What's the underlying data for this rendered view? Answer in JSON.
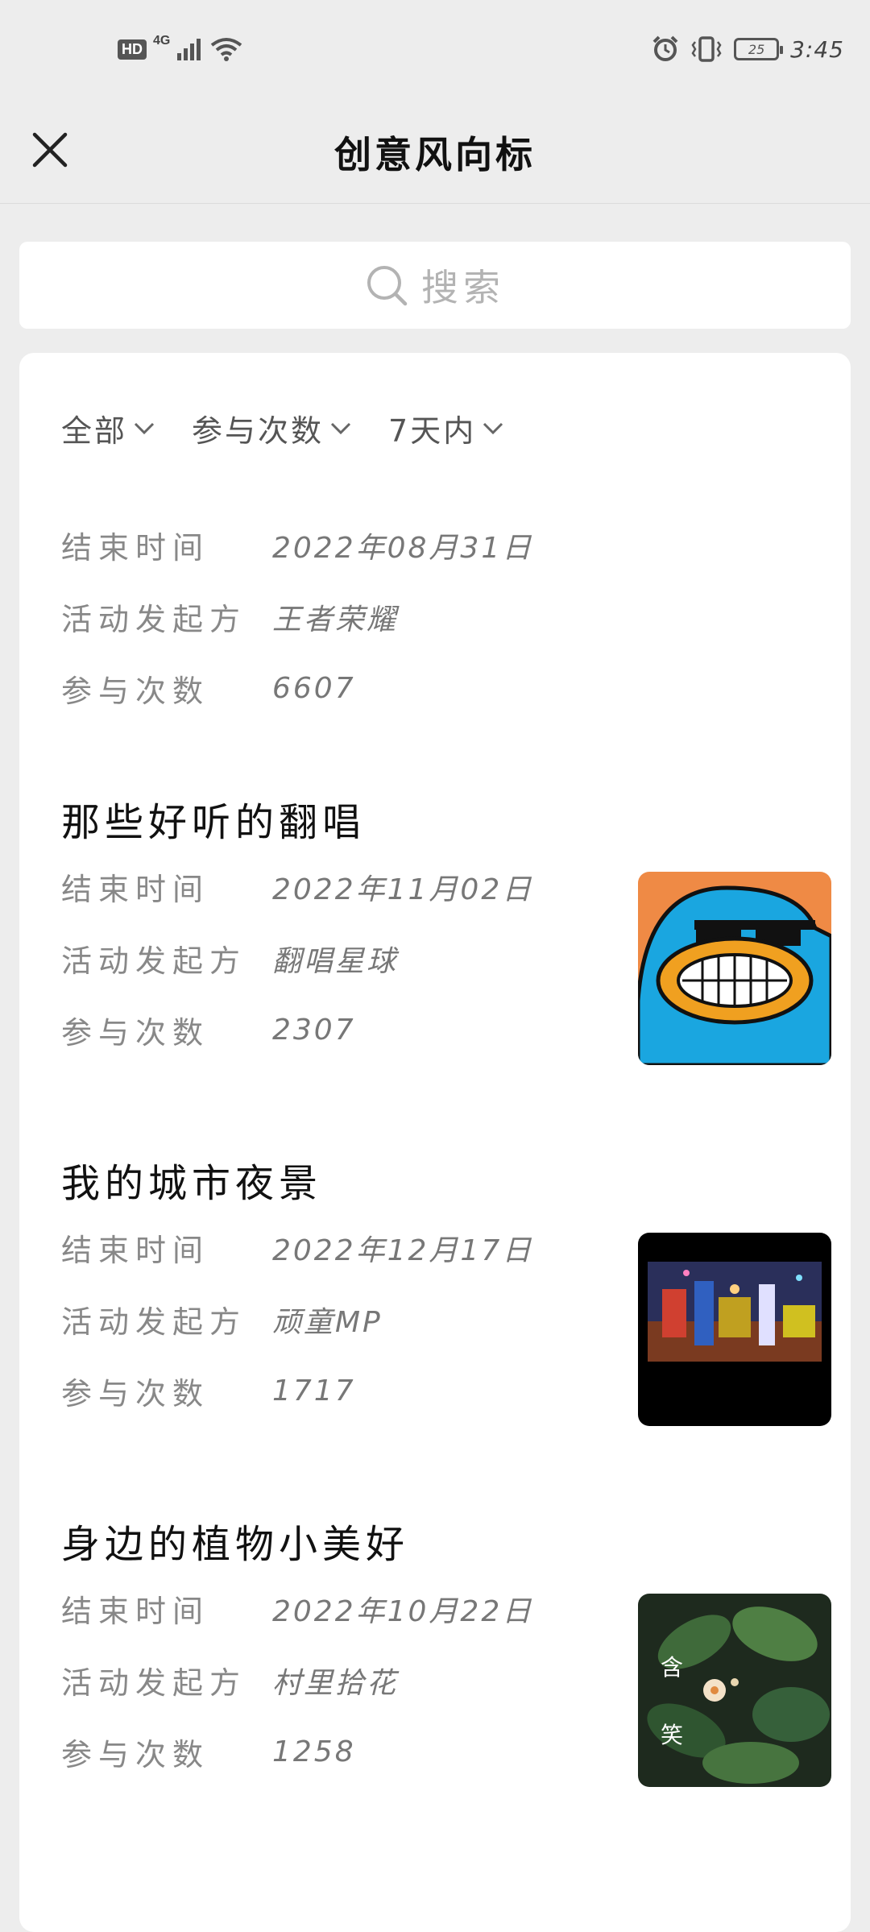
{
  "status_bar": {
    "hd": "HD",
    "network": "4G",
    "battery": "25",
    "time": "3:45"
  },
  "header": {
    "title": "创意风向标"
  },
  "search": {
    "placeholder": "搜索"
  },
  "filters": [
    {
      "label": "全部"
    },
    {
      "label": "参与次数"
    },
    {
      "label": "7天内"
    }
  ],
  "labels": {
    "end_time": "结束时间",
    "organizer": "活动发起方",
    "count": "参与次数"
  },
  "activities": [
    {
      "title": "",
      "end_time": "2022年08月31日",
      "organizer": "王者荣耀",
      "count": "6607"
    },
    {
      "title": "那些好听的翻唱",
      "end_time": "2022年11月02日",
      "organizer": "翻唱星球",
      "count": "2307"
    },
    {
      "title": "我的城市夜景",
      "end_time": "2022年12月17日",
      "organizer": "顽童MP",
      "count": "1717"
    },
    {
      "title": "身边的植物小美好",
      "end_time": "2022年10月22日",
      "organizer": "村里拾花",
      "count": "1258",
      "thumb_caption": "含笑"
    }
  ],
  "colors": {
    "background": "#ededed",
    "card": "#ffffff",
    "thumb_orange": "#ef8a45",
    "thumb_blue": "#1aa6e0"
  }
}
